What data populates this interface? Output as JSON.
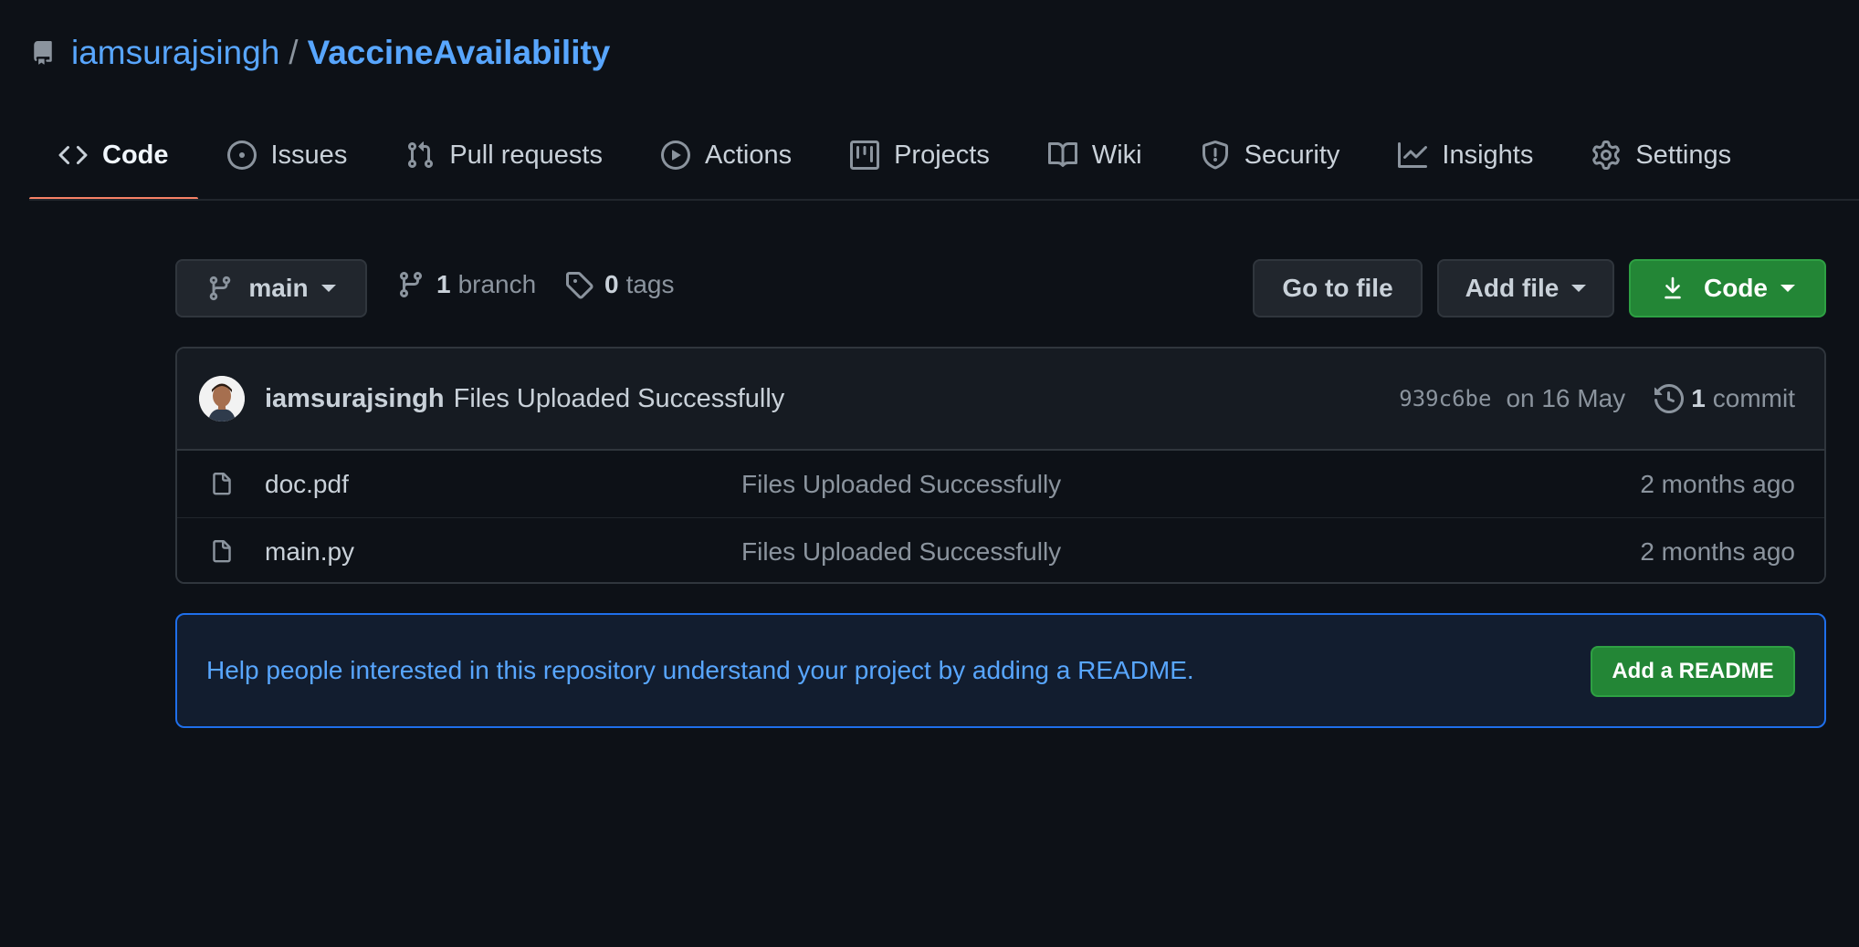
{
  "repo": {
    "owner": "iamsurajsingh",
    "separator": "/",
    "name": "VaccineAvailability"
  },
  "tabs": [
    {
      "label": "Code",
      "icon": "code-icon",
      "active": true
    },
    {
      "label": "Issues",
      "icon": "issue-opened-icon"
    },
    {
      "label": "Pull requests",
      "icon": "git-pull-request-icon"
    },
    {
      "label": "Actions",
      "icon": "play-icon"
    },
    {
      "label": "Projects",
      "icon": "project-icon"
    },
    {
      "label": "Wiki",
      "icon": "book-icon"
    },
    {
      "label": "Security",
      "icon": "shield-icon"
    },
    {
      "label": "Insights",
      "icon": "graph-icon"
    },
    {
      "label": "Settings",
      "icon": "gear-icon"
    }
  ],
  "toolbar": {
    "branch": "main",
    "branch_count": "1",
    "branch_label": "branch",
    "tag_count": "0",
    "tag_label": "tags",
    "go_to_file": "Go to file",
    "add_file": "Add file",
    "code": "Code"
  },
  "latest_commit": {
    "author": "iamsurajsingh",
    "message": "Files Uploaded Successfully",
    "sha": "939c6be",
    "date": "on 16 May",
    "count": "1",
    "count_label": "commit"
  },
  "files": [
    {
      "name": "doc.pdf",
      "message": "Files Uploaded Successfully",
      "age": "2 months ago"
    },
    {
      "name": "main.py",
      "message": "Files Uploaded Successfully",
      "age": "2 months ago"
    }
  ],
  "readme_banner": {
    "text": "Help people interested in this repository understand your project by adding a README.",
    "button": "Add a README"
  },
  "colors": {
    "background": "#0d1117",
    "link": "#58a6ff",
    "primary_button": "#238636",
    "active_tab_underline": "#f78166"
  }
}
